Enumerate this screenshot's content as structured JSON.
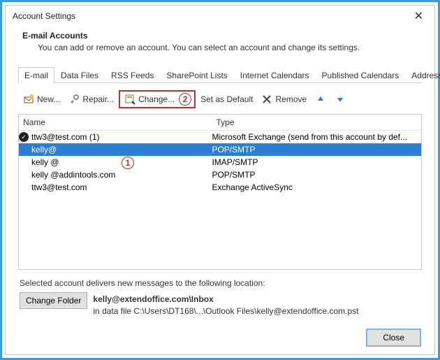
{
  "window": {
    "title": "Account Settings"
  },
  "header": {
    "heading": "E-mail Accounts",
    "subheading": "You can add or remove an account. You can select an account and change its settings."
  },
  "tabs": [
    "E-mail",
    "Data Files",
    "RSS Feeds",
    "SharePoint Lists",
    "Internet Calendars",
    "Published Calendars",
    "Address Books"
  ],
  "toolbar": {
    "new": "New...",
    "repair": "Repair...",
    "change": "Change...",
    "set_default": "Set as Default",
    "remove": "Remove"
  },
  "list": {
    "columns": {
      "name": "Name",
      "type": "Type"
    },
    "rows": [
      {
        "name": "ttw3@test.com (1)",
        "type": "Microsoft Exchange (send from this account by def..."
      },
      {
        "name": "kelly@",
        "type": "POP/SMTP"
      },
      {
        "name": "kelly        @",
        "type": "IMAP/SMTP"
      },
      {
        "name": "kelly      @addintools.com",
        "type": "POP/SMTP"
      },
      {
        "name": "ttw3@test.com",
        "type": "Exchange ActiveSync"
      }
    ]
  },
  "delivery": {
    "caption": "Selected account delivers new messages to the following location:",
    "change_folder": "Change Folder",
    "location": "kelly@extendoffice.com\\Inbox",
    "path": "in data file C:\\Users\\DT168\\...\\Outlook Files\\kelly@extendoffice.com.pst"
  },
  "footer": {
    "close": "Close"
  },
  "annotations": {
    "callout1": "1",
    "callout2": "2"
  }
}
